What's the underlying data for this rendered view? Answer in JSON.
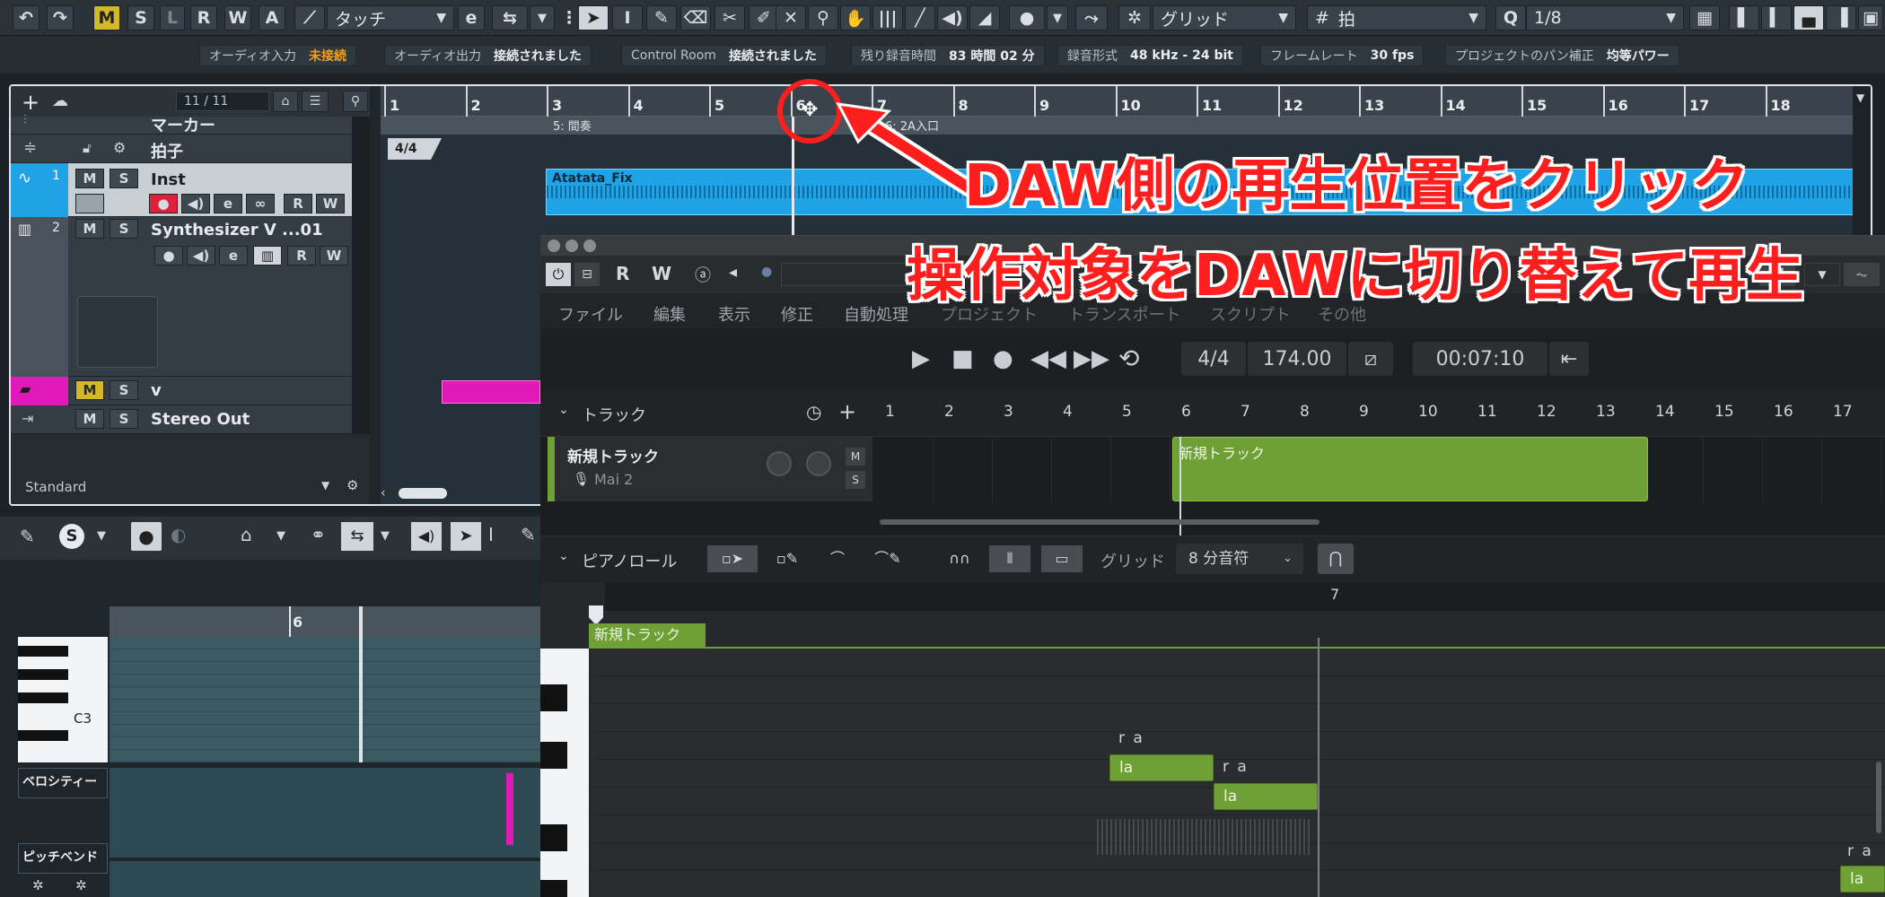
{
  "toolbar": {
    "undo_icon": "undo-icon",
    "redo_icon": "redo-icon",
    "modes": [
      "M",
      "S",
      "L",
      "R",
      "W",
      "A"
    ],
    "automation_mode": "タッチ",
    "snap_type_label": "グリッド",
    "grid_type_label": "拍",
    "quantize_label": "1/8"
  },
  "status": {
    "audio_in_label": "オーディオ入力",
    "audio_in_value": "未接続",
    "audio_out_label": "オーディオ出力",
    "audio_out_value": "接続されました",
    "control_room_label": "Control Room",
    "control_room_value": "接続されました",
    "rec_time_label": "残り録音時間",
    "rec_time_value": "83 時間 02 分",
    "rec_format_label": "録音形式",
    "rec_format_value": "48 kHz - 24 bit",
    "frame_rate_label": "フレームレート",
    "frame_rate_value": "30 fps",
    "pan_label": "プロジェクトのパン補正",
    "pan_value": "均等パワー"
  },
  "project": {
    "track_count": "11 / 11",
    "ruler_numbers": [
      "1",
      "2",
      "3",
      "4",
      "5",
      "6",
      "7",
      "8",
      "9",
      "10",
      "11",
      "12",
      "13",
      "14",
      "15",
      "16",
      "17",
      "18"
    ],
    "marker_row_text_1": "5: 間奏",
    "marker_row_text_2": "6: 2A入口",
    "signature": "4/4",
    "clip_name": "Atatata_Fix",
    "footer_label": "Standard",
    "tracks": [
      {
        "name": "マーカー"
      },
      {
        "name": "拍子"
      },
      {
        "number": "1",
        "name": "Inst"
      },
      {
        "number": "2",
        "name": "Synthesizer V ...01"
      },
      {
        "name": "v"
      },
      {
        "name": "Stereo Out"
      }
    ],
    "btn_m": "M",
    "btn_s": "S",
    "btn_r": "R",
    "btn_w": "W",
    "btn_e": "e"
  },
  "lower_editor": {
    "ruler_number": "6",
    "key_label": "C3",
    "velocity_label": "ベロシティー",
    "pitchbend_label": "ピッチベンド"
  },
  "svwin": {
    "menu": [
      "ファイル",
      "編集",
      "表示",
      "修正",
      "自動処理",
      "プロジェクト",
      "トランスポート",
      "スクリプト",
      "その他"
    ],
    "time_signature": "4/4",
    "tempo": "174.00",
    "time_display": "00:07:10",
    "tracks_title": "トラック",
    "ruler_numbers": [
      "1",
      "2",
      "3",
      "4",
      "5",
      "6",
      "7",
      "8",
      "9",
      "10",
      "11",
      "12",
      "13",
      "14",
      "15",
      "16",
      "17"
    ],
    "track_name": "新規トラック",
    "voice_name": "Mai 2",
    "track_m": "M",
    "track_s": "S",
    "clip_name": "新規トラック",
    "pianoroll_title": "ピアノロール",
    "grid_label": "グリッド",
    "grid_value": "8 分音符",
    "pr_ruler_number": "7",
    "pr_clip_label": "新規トラック",
    "notes": [
      {
        "phoneme": "r a",
        "lyric": "la"
      },
      {
        "phoneme": "r a",
        "lyric": "la"
      },
      {
        "phoneme": "r a",
        "lyric": "la"
      }
    ]
  },
  "annotations": {
    "line1": "DAW側の再生位置をクリック",
    "line2": "操作対象をDAWに切り替えて再生",
    "color": "#ff1e1e"
  },
  "colors": {
    "cubase_clip": "#1fa3e6",
    "sv_clip": "#6fa036",
    "record_red": "#e0203a",
    "mute_yellow": "#d4b82a",
    "folder_magenta": "#e01ab8"
  }
}
